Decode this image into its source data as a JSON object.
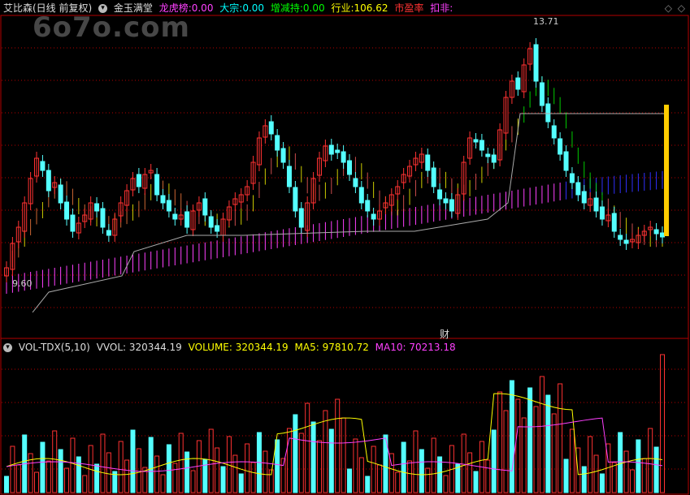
{
  "header": {
    "stock_name": "艾比森(日线 前复权)",
    "indicator_name": "金玉满堂",
    "longhubang_label": "龙虎榜:",
    "longhubang_value": "0.00",
    "dazong_label": "大宗:",
    "dazong_value": "0.00",
    "zengjianchi_label": "增减持:",
    "zengjianchi_value": "0.00",
    "hangye_label": "行业:",
    "hangye_value": "106.62",
    "pe_label": "市盈率",
    "koufei_label": "扣非:"
  },
  "watermark": "6o7o.com",
  "price_chart": {
    "high_label": "13.71",
    "low_label": "9.60",
    "finance_marker": "财"
  },
  "volume_header": {
    "indicator": "VOL-TDX(5,10)",
    "vvol_label": "VVOL:",
    "vvol_value": "320344.19",
    "volume_label": "VOLUME:",
    "volume_value": "320344.19",
    "ma5_label": "MA5:",
    "ma5_value": "97810.72",
    "ma10_label": "MA10:",
    "ma10_value": "70213.18"
  },
  "colors": {
    "up": "#ff3232",
    "down": "#54ffff",
    "grid": "#b40000",
    "magenta": "#ff40ff",
    "yellow": "#ffff00",
    "green": "#00ff00",
    "blue": "#3030ff"
  }
}
